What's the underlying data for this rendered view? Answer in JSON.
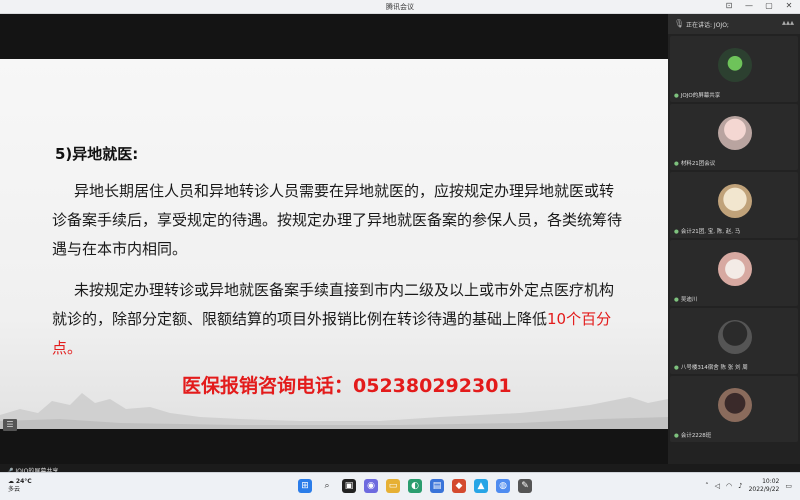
{
  "window": {
    "title": "腾讯会议"
  },
  "slide": {
    "heading": "5)异地就医:",
    "para1": "异地长期居住人员和异地转诊人员需要在异地就医的，应按规定办理异地就医或转诊备案手续后，享受规定的待遇。按规定办理了异地就医备案的参保人员，各类统筹待遇与在本市内相同。",
    "para2_main": "未按规定办理转诊或异地就医备案手续直接到市内二级及以上或市外定点医疗机构就诊的，除部分定额、限额结算的项目外报销比例在转诊待遇的基础上降低",
    "para2_red": "10个百分点。",
    "hotline": "医保报销咨询电话：052380292301"
  },
  "share": {
    "label": "JOJO的屏幕共享"
  },
  "panel": {
    "speaking": "正在讲话: JOJO;",
    "participants": [
      {
        "name": "JOJO的屏幕共享"
      },
      {
        "name": "材料21团会议"
      },
      {
        "name": "会计21团, 宝, 陈, 赵, 马"
      },
      {
        "name": "吴迪川"
      },
      {
        "name": "八号楼314宿舍 陈 张 刘 周"
      },
      {
        "name": "会计2228班"
      }
    ]
  },
  "taskbar": {
    "temp": "24°C",
    "weather": "多云",
    "time": "10:02",
    "date": "2022/9/22"
  },
  "colors": {
    "accent_red": "#e31b1b"
  }
}
